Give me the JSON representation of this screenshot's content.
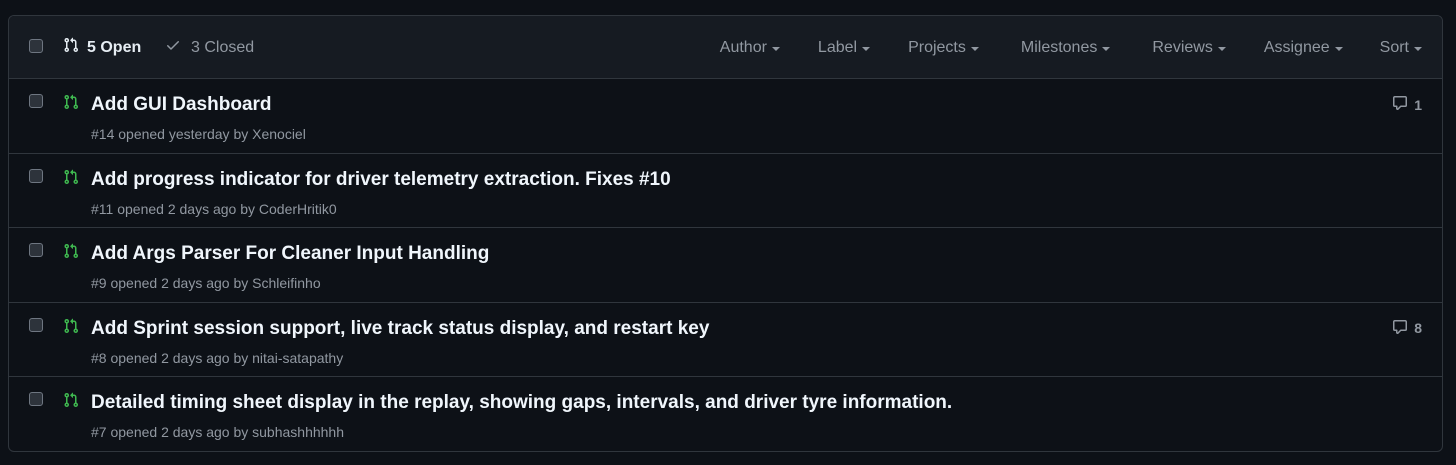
{
  "header": {
    "open_label": "5 Open",
    "closed_label": "3 Closed",
    "filters": [
      "Author",
      "Label",
      "Projects",
      "Milestones",
      "Reviews",
      "Assignee",
      "Sort"
    ]
  },
  "prs": [
    {
      "title": "Add GUI Dashboard",
      "number": "#14",
      "opened": "opened yesterday by",
      "author": "Xenociel",
      "comments": "1"
    },
    {
      "title": "Add progress indicator for driver telemetry extraction. Fixes #10",
      "number": "#11",
      "opened": "opened 2 days ago by",
      "author": "CoderHritik0",
      "comments": ""
    },
    {
      "title": "Add Args Parser For Cleaner Input Handling",
      "number": "#9",
      "opened": "opened 2 days ago by",
      "author": "Schleifinho",
      "comments": ""
    },
    {
      "title": "Add Sprint session support, live track status display, and restart key",
      "number": "#8",
      "opened": "opened 2 days ago by",
      "author": "nitai-satapathy",
      "comments": "8"
    },
    {
      "title": "Detailed timing sheet display in the replay, showing gaps, intervals, and driver tyre information.",
      "number": "#7",
      "opened": "opened 2 days ago by",
      "author": "subhashhhhhh",
      "comments": ""
    }
  ],
  "colors": {
    "background": "#0d1117",
    "header_bg": "#161b22",
    "border": "#30363d",
    "open_green": "#3fb950",
    "muted": "#9198a1"
  },
  "icons": {
    "pr": "git-pull-request-icon",
    "check": "check-icon",
    "comment": "comment-icon"
  }
}
